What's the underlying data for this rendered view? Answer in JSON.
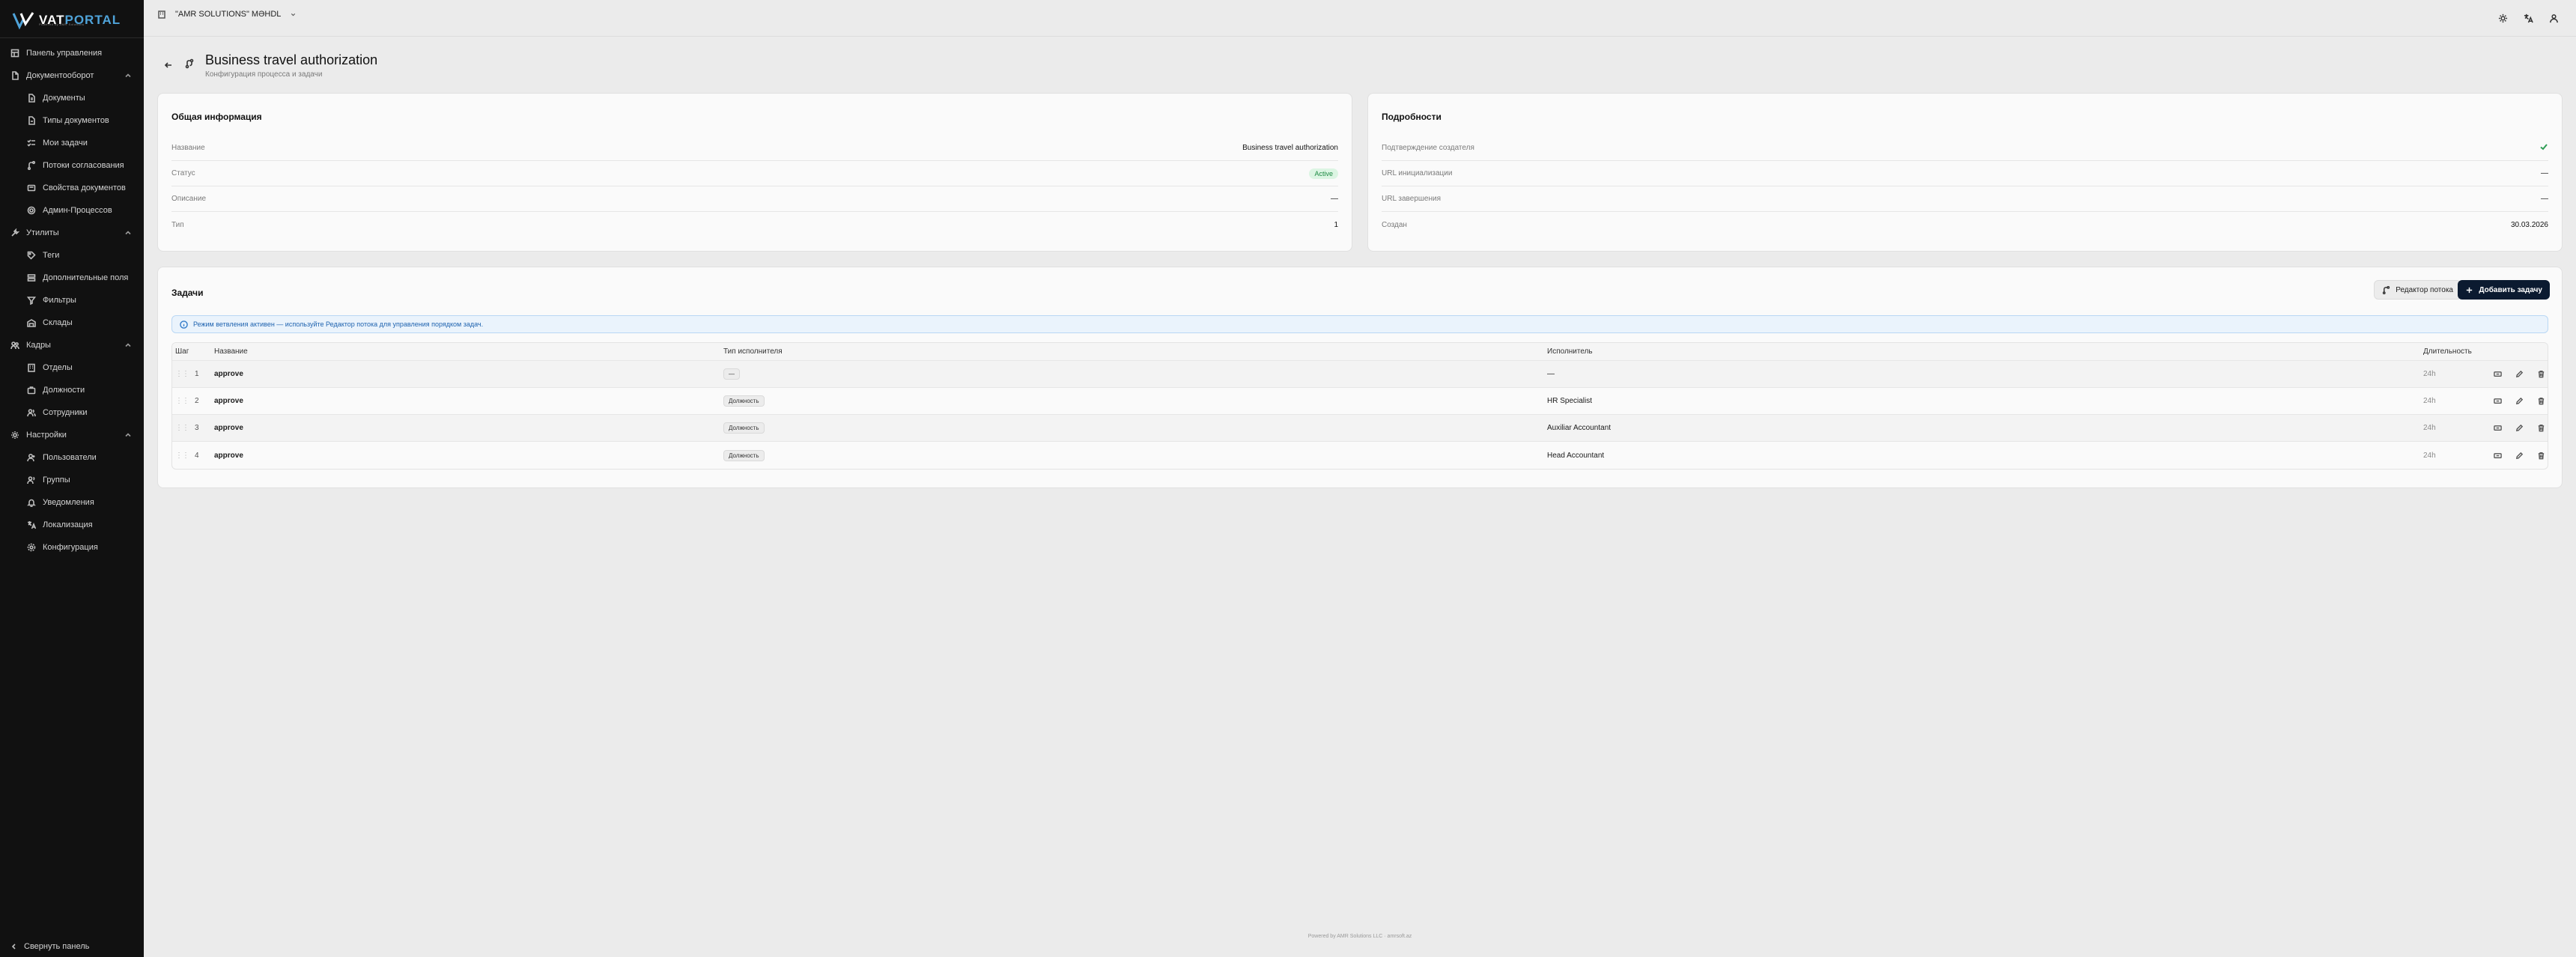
{
  "brand": {
    "name_part1": "VAT",
    "name_part2": "PORTAL",
    "tagline": "Powered by AMR Solutions"
  },
  "sidebar": {
    "items": [
      {
        "label": "Панель управления",
        "icon": "dashboard-icon",
        "level": "top"
      },
      {
        "label": "Документооборот",
        "icon": "file-icon",
        "level": "top",
        "expanded": true
      },
      {
        "label": "Документы",
        "icon": "document-icon",
        "level": "sub"
      },
      {
        "label": "Типы документов",
        "icon": "file-type-icon",
        "level": "sub"
      },
      {
        "label": "Мои задачи",
        "icon": "check-list-icon",
        "level": "sub"
      },
      {
        "label": "Потоки согласования",
        "icon": "flow-icon",
        "level": "sub"
      },
      {
        "label": "Свойства документов",
        "icon": "properties-icon",
        "level": "sub"
      },
      {
        "label": "Админ-Процессов",
        "icon": "settings-icon",
        "level": "sub"
      },
      {
        "label": "Утилиты",
        "icon": "wrench-icon",
        "level": "top",
        "expanded": true
      },
      {
        "label": "Теги",
        "icon": "tag-icon",
        "level": "sub"
      },
      {
        "label": "Дополнительные поля",
        "icon": "fields-icon",
        "level": "sub"
      },
      {
        "label": "Фильтры",
        "icon": "filter-icon",
        "level": "sub"
      },
      {
        "label": "Склады",
        "icon": "warehouse-icon",
        "level": "sub"
      },
      {
        "label": "Кадры",
        "icon": "people-icon",
        "level": "top",
        "expanded": true
      },
      {
        "label": "Отделы",
        "icon": "building-icon",
        "level": "sub"
      },
      {
        "label": "Должности",
        "icon": "briefcase-icon",
        "level": "sub"
      },
      {
        "label": "Сотрудники",
        "icon": "users-icon",
        "level": "sub"
      },
      {
        "label": "Настройки",
        "icon": "gear-icon",
        "level": "top",
        "expanded": true
      },
      {
        "label": "Пользователи",
        "icon": "user-icon",
        "level": "sub"
      },
      {
        "label": "Группы",
        "icon": "group-icon",
        "level": "sub"
      },
      {
        "label": "Уведомления",
        "icon": "bell-icon",
        "level": "sub"
      },
      {
        "label": "Локализация",
        "icon": "translate-icon",
        "level": "sub"
      },
      {
        "label": "Конфигурация",
        "icon": "config-icon",
        "level": "sub"
      }
    ],
    "collapse_label": "Свернуть панель"
  },
  "topbar": {
    "org_name": "\"AMR SOLUTIONS\" MƏHDL"
  },
  "page": {
    "title": "Business travel authorization",
    "subtitle": "Конфигурация процесса и задачи"
  },
  "general": {
    "title": "Общая информация",
    "rows": [
      {
        "label": "Название",
        "value": "Business travel authorization"
      },
      {
        "label": "Статус",
        "value": "Active"
      },
      {
        "label": "Описание",
        "value": "—"
      },
      {
        "label": "Тип",
        "value": "1"
      }
    ]
  },
  "details": {
    "title": "Подробности",
    "rows": [
      {
        "label": "Подтверждение создателя",
        "value": ""
      },
      {
        "label": "URL инициализации",
        "value": "—"
      },
      {
        "label": "URL завершения",
        "value": "—"
      },
      {
        "label": "Создан",
        "value": "30.03.2026"
      }
    ]
  },
  "tasks": {
    "title": "Задачи",
    "flow_editor_label": "Редактор потока",
    "add_task_label": "Добавить задачу",
    "info_text": "Режим ветвления активен — используйте Редактор потока для управления порядком задач.",
    "columns": [
      "Шаг",
      "Название",
      "Тип исполнителя",
      "Исполнитель",
      "Длительность"
    ],
    "rows": [
      {
        "step": "1",
        "name": "approve",
        "type": "—",
        "executor": "—",
        "duration": "24h"
      },
      {
        "step": "2",
        "name": "approve",
        "type": "Должность",
        "executor": "HR Specialist",
        "duration": "24h"
      },
      {
        "step": "3",
        "name": "approve",
        "type": "Должность",
        "executor": "Auxiliar Accountant",
        "duration": "24h"
      },
      {
        "step": "4",
        "name": "approve",
        "type": "Должность",
        "executor": "Head Accountant",
        "duration": "24h"
      }
    ]
  },
  "footer": {
    "text": "Powered by AMR Solutions LLC · amrsoft.az"
  }
}
